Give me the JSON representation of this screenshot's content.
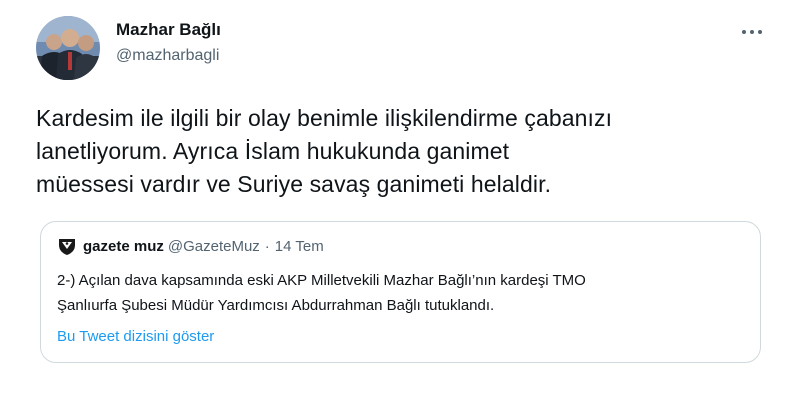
{
  "author": {
    "display_name": "Mazhar Bağlı",
    "handle": "@mazharbagli",
    "avatar_icon": "user-avatar-photo"
  },
  "more_icon": "more-options-icon",
  "tweet": {
    "text_lines": [
      "Kardesim ile ilgili bir olay benimle ilişkilendirme çabanızı",
      "lanetliyorum. Ayrıca İslam hukukunda ganimet",
      "müessesi vardır ve Suriye savaş ganimeti helaldir."
    ]
  },
  "quoted_tweet": {
    "name": "gazete muz",
    "handle": "@GazeteMuz",
    "separator": "·",
    "date": "14 Tem",
    "avatar_icon": "shield-logo-icon",
    "text_lines": [
      "2-) Açılan dava kapsamında eski AKP Milletvekili Mazhar Bağlı’nın kardeşi TMO",
      "Şanlıurfa Şubesi Müdür Yardımcısı Abdurrahman Bağlı tutuklandı."
    ],
    "thread_link": "Bu Tweet dizisini göster"
  },
  "colors": {
    "text": "#0f1419",
    "secondary": "#536471",
    "link": "#1d9bf0",
    "border": "#cfd9de"
  }
}
